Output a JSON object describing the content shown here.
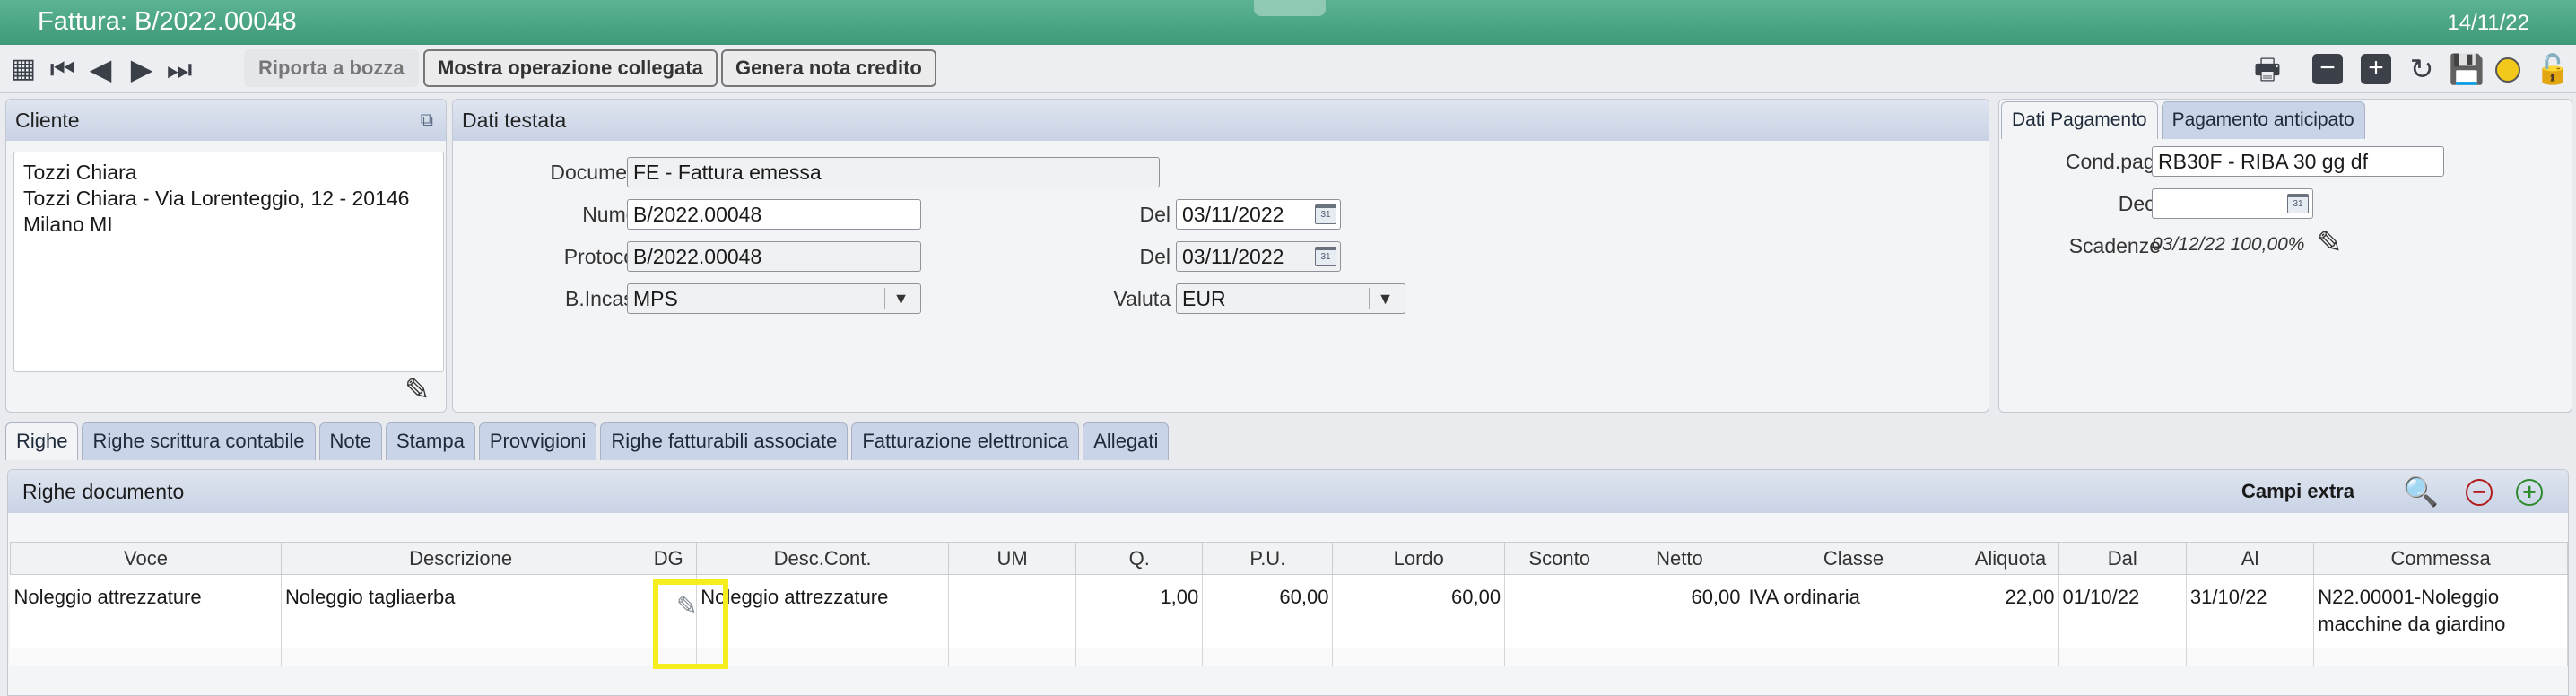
{
  "window": {
    "title": "Fattura: B/2022.00048",
    "date": "14/11/22"
  },
  "toolbar": {
    "riporta": "Riporta a bozza",
    "mostra": "Mostra operazione collegata",
    "genera": "Genera nota credito",
    "icons": [
      "grid-icon",
      "first-icon",
      "prev-icon",
      "next-icon",
      "last-icon",
      "print-icon",
      "remove-icon",
      "add-icon",
      "refresh-icon",
      "save-icon",
      "status-icon",
      "lock-icon"
    ]
  },
  "cliente": {
    "title": "Cliente",
    "line1": "Tozzi Chiara",
    "line2": "Tozzi Chiara - Via Lorenteggio, 12 - 20146",
    "line3": "Milano MI"
  },
  "testata": {
    "title": "Dati testata",
    "documento_label": "Documento",
    "documento": "FE - Fattura emessa",
    "numero_label": "Numero",
    "numero": "B/2022.00048",
    "protocollo_label": "Protocollo",
    "protocollo": "B/2022.00048",
    "bincasso_label": "B.Incasso",
    "bincasso": "MPS",
    "del_label": "Del",
    "del1": "03/11/2022",
    "del2": "03/11/2022",
    "valuta_label": "Valuta",
    "valuta": "EUR"
  },
  "pagamento": {
    "tab1": "Dati Pagamento",
    "tab2": "Pagamento anticipato",
    "cond_label": "Cond.pag.",
    "cond": "RB30F - RIBA 30 gg df",
    "dec_label": "Dec.",
    "dec": "",
    "scad_label": "Scadenze",
    "scad": "03/12/22 100,00%"
  },
  "tabs": [
    "Righe",
    "Righe scrittura contabile",
    "Note",
    "Stampa",
    "Provvigioni",
    "Righe fatturabili associate",
    "Fatturazione elettronica",
    "Allegati"
  ],
  "grid": {
    "title": "Righe documento",
    "extra": "Campi extra",
    "columns": [
      "Voce",
      "Descrizione",
      "DG",
      "Desc.Cont.",
      "UM",
      "Q.",
      "P.U.",
      "Lordo",
      "Sconto",
      "Netto",
      "Classe",
      "Aliquota",
      "Dal",
      "Al",
      "Commessa"
    ],
    "row": {
      "voce": "Noleggio attrezzature",
      "descrizione": "Noleggio tagliaerba",
      "desc_cont": "Noleggio attrezzature",
      "um": "",
      "q": "1,00",
      "pu": "60,00",
      "lordo": "60,00",
      "sconto": "",
      "netto": "60,00",
      "classe": "IVA ordinaria",
      "aliquota": "22,00",
      "dal": "01/10/22",
      "al": "31/10/22",
      "commessa": "N22.00001-Noleggio macchine da giardino"
    }
  },
  "colors": {
    "title_bar": "#4aa682",
    "highlight": "#f5ee1f"
  }
}
